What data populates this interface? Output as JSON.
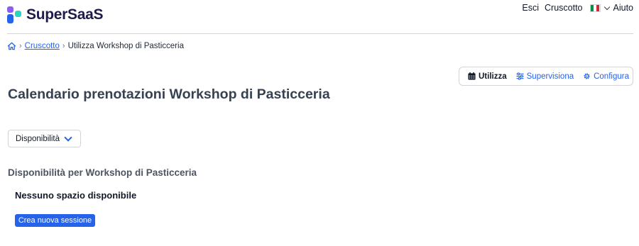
{
  "brand": {
    "name": "SuperSaaS"
  },
  "topnav": {
    "logout": "Esci",
    "dashboard": "Cruscotto",
    "help": "Aiuto"
  },
  "breadcrumb": {
    "dashboard": "Cruscotto",
    "current": "Utilizza Workshop di Pasticceria"
  },
  "modes": {
    "use": "Utilizza",
    "supervise": "Supervisiona",
    "configure": "Configura"
  },
  "page": {
    "title": "Calendario prenotazioni Workshop di Pasticceria"
  },
  "view_select": {
    "selected": "Disponibilità"
  },
  "availability": {
    "title": "Disponibilità per Workshop di Pasticceria",
    "empty_message": "Nessuno spazio disponibile",
    "create_button": "Crea nuova sessione"
  },
  "colors": {
    "accent": "#2563eb",
    "flag": [
      "#009246",
      "#ffffff",
      "#ce2b37"
    ]
  }
}
